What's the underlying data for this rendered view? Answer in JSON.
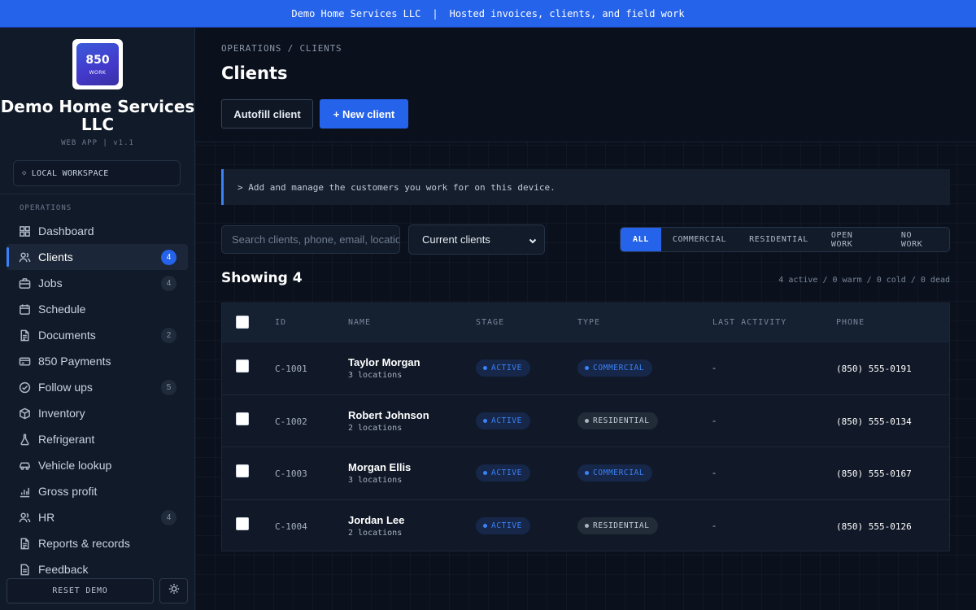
{
  "banner": {
    "company": "Demo Home Services LLC",
    "separator": "|",
    "tagline": "Hosted invoices, clients, and field work"
  },
  "sidebar": {
    "logo_line1": "850",
    "logo_line2": "WORK",
    "brand_name": "Demo Home Services LLC",
    "brand_sub": "WEB APP | v1.1",
    "workspace_icon": "diamond-icon",
    "workspace_label": "LOCAL WORKSPACE",
    "section_label": "OPERATIONS",
    "items": [
      {
        "label": "Dashboard",
        "icon": "grid-icon",
        "badge": "",
        "active": false
      },
      {
        "label": "Clients",
        "icon": "users-icon",
        "badge": "4",
        "active": true
      },
      {
        "label": "Jobs",
        "icon": "briefcase-icon",
        "badge": "4",
        "active": false
      },
      {
        "label": "Schedule",
        "icon": "calendar-icon",
        "badge": "",
        "active": false
      },
      {
        "label": "Documents",
        "icon": "document-icon",
        "badge": "2",
        "active": false
      },
      {
        "label": "850 Payments",
        "icon": "card-icon",
        "badge": "",
        "active": false
      },
      {
        "label": "Follow ups",
        "icon": "check-circle-icon",
        "badge": "5",
        "active": false
      },
      {
        "label": "Inventory",
        "icon": "box-icon",
        "badge": "",
        "active": false
      },
      {
        "label": "Refrigerant",
        "icon": "flask-icon",
        "badge": "",
        "active": false
      },
      {
        "label": "Vehicle lookup",
        "icon": "car-icon",
        "badge": "",
        "active": false
      },
      {
        "label": "Gross profit",
        "icon": "bar-chart-icon",
        "badge": "",
        "active": false
      },
      {
        "label": "HR",
        "icon": "users-icon",
        "badge": "4",
        "active": false
      },
      {
        "label": "Reports & records",
        "icon": "document-icon",
        "badge": "",
        "active": false
      },
      {
        "label": "Feedback",
        "icon": "message-icon",
        "badge": "",
        "active": false
      }
    ],
    "reset_label": "RESET DEMO",
    "theme_icon": "sun-icon"
  },
  "header": {
    "breadcrumb": "OPERATIONS / CLIENTS",
    "title": "Clients",
    "autofill_label": "Autofill client",
    "new_label": "+ New client"
  },
  "info_text": "> Add and manage the customers you work for on this device.",
  "search": {
    "placeholder": "Search clients, phone, email, locations",
    "value": ""
  },
  "view_select": {
    "value": "Current clients"
  },
  "filters": [
    {
      "label": "ALL",
      "active": true
    },
    {
      "label": "COMMERCIAL",
      "active": false
    },
    {
      "label": "RESIDENTIAL",
      "active": false
    },
    {
      "label": "OPEN WORK",
      "active": false
    },
    {
      "label": "NO WORK",
      "active": false
    }
  ],
  "showing_label": "Showing 4",
  "counts_label": "4 active / 0 warm / 0 cold / 0 dead",
  "table": {
    "headers": [
      "ID",
      "NAME",
      "STAGE",
      "TYPE",
      "LAST ACTIVITY",
      "PHONE"
    ],
    "rows": [
      {
        "id": "C-1001",
        "name": "Taylor Morgan",
        "locations": "3 locations",
        "stage": "ACTIVE",
        "type": "COMMERCIAL",
        "last": "-",
        "phone": "(850) 555-0191"
      },
      {
        "id": "C-1002",
        "name": "Robert Johnson",
        "locations": "2 locations",
        "stage": "ACTIVE",
        "type": "RESIDENTIAL",
        "last": "-",
        "phone": "(850) 555-0134"
      },
      {
        "id": "C-1003",
        "name": "Morgan Ellis",
        "locations": "3 locations",
        "stage": "ACTIVE",
        "type": "COMMERCIAL",
        "last": "-",
        "phone": "(850) 555-0167"
      },
      {
        "id": "C-1004",
        "name": "Jordan Lee",
        "locations": "2 locations",
        "stage": "ACTIVE",
        "type": "RESIDENTIAL",
        "last": "-",
        "phone": "(850) 555-0126"
      }
    ]
  },
  "colors": {
    "accent": "#2563eb",
    "banner": "#2563eb",
    "background": "#0b111c",
    "sidebar": "#111a28"
  }
}
